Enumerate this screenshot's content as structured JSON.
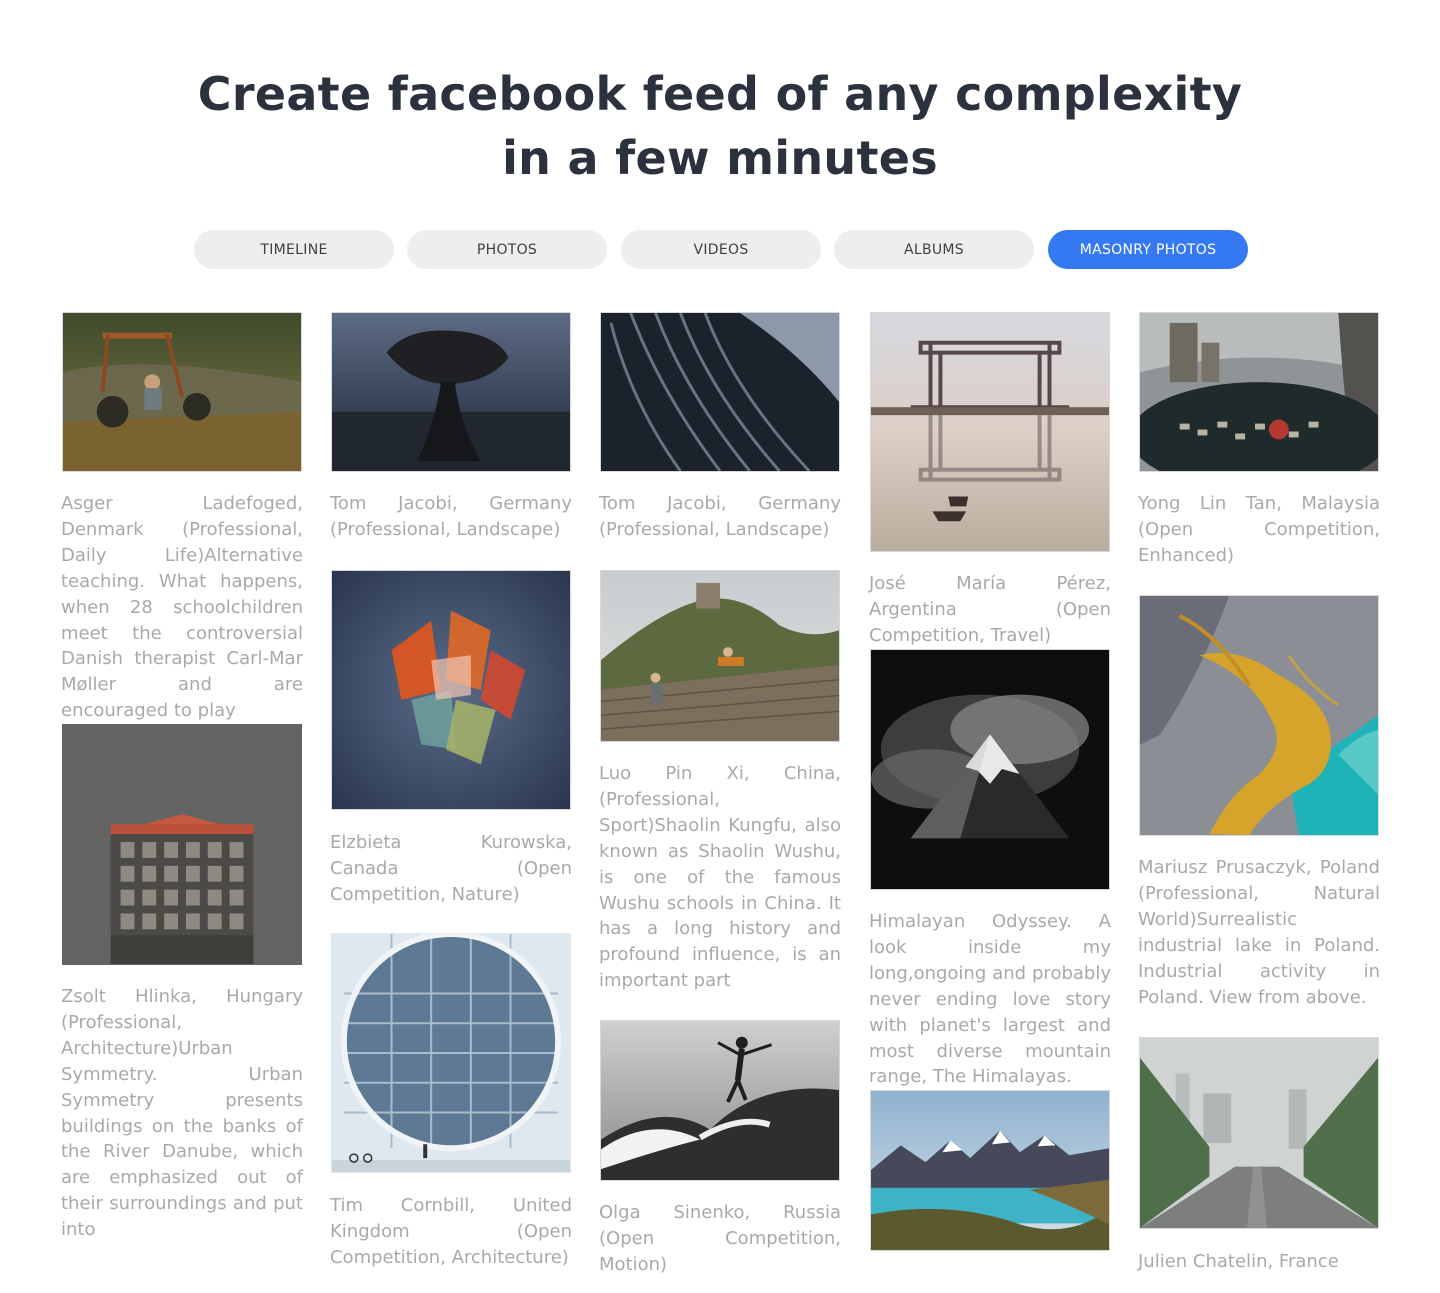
{
  "headline": {
    "line1": "Create facebook feed of any complexity",
    "line2": "in a few minutes"
  },
  "tabs": [
    {
      "label": "TIMELINE",
      "active": false
    },
    {
      "label": "PHOTOS",
      "active": false
    },
    {
      "label": "VIDEOS",
      "active": false
    },
    {
      "label": "ALBUMS",
      "active": false
    },
    {
      "label": "MASONRY PHOTOS",
      "active": true
    }
  ],
  "colors": {
    "accent": "#3579f2",
    "tab_bg": "#eeeeee",
    "headline": "#2c323d",
    "caption": "#a9a9a9"
  },
  "posts": [
    {
      "caption": "Asger Ladefoged, Denmark (Professional, Daily Life)Alternative teaching. What happens, when 28 schoolchildren meet the controversial Danish therapist Carl-Mar Møller and are encouraged to play",
      "icon": "mud-buggy-photo"
    },
    {
      "caption": "Zsolt Hlinka, Hungary (Professional, Architecture)Urban Symmetry. Urban Symmetry presents buildings on the banks of the River Danube, which are emphasized out of their surroundings and put into",
      "icon": "building-photo"
    },
    {
      "caption": "Tom Jacobi, Germany (Professional, Landscape)",
      "icon": "balancing-rock-photo"
    },
    {
      "caption": "Elzbieta Kurowska, Canada (Open Competition, Nature)",
      "icon": "glass-crystals-photo"
    },
    {
      "caption": "Tim Cornbill, United Kingdom (Open Competition, Architecture)",
      "icon": "round-window-photo"
    },
    {
      "caption": "Tom Jacobi, Germany (Professional, Landscape)",
      "icon": "wave-rock-photo"
    },
    {
      "caption": "Luo Pin Xi, China, (Professional, Sport)Shaolin Kungfu, also known as Shaolin Wushu, is one of the famous Wushu schools in China. It has a long history and profound influence, is an important part",
      "icon": "great-wall-kungfu-photo"
    },
    {
      "caption": "Olga Sinenko, Russia (Open Competition, Motion)",
      "icon": "surfer-photo"
    },
    {
      "caption": "José María Pérez, Argentina (Open Competition, Travel)",
      "icon": "bridge-reflection-photo"
    },
    {
      "caption": "Himalayan Odyssey. A look inside my long,ongoing and probably never ending love story with planet's largest and most diverse mountain range, The Himalayas.",
      "icon": "himalaya-peak-photo"
    },
    {
      "caption": "",
      "icon": "patagonia-lake-photo"
    },
    {
      "caption": "Yong Lin Tan, Malaysia (Open Competition, Enhanced)",
      "icon": "city-fisheye-photo"
    },
    {
      "caption": "Mariusz Prusaczyk, Poland (Professional, Natural World)Surrealistic industrial lake in Poland. Industrial activity in Poland. View from above.",
      "icon": "industrial-lake-photo"
    },
    {
      "caption": "Julien Chatelin, France",
      "icon": "foggy-road-photo"
    }
  ]
}
